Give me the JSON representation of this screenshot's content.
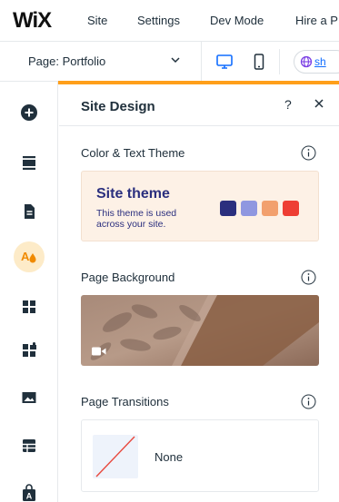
{
  "topbar": {
    "logo": "WiX",
    "menu": [
      "Site",
      "Settings",
      "Dev Mode",
      "Hire a P"
    ]
  },
  "pagebar": {
    "page_label": "Page: Portfolio",
    "site_button": "sh"
  },
  "sidebar": {
    "items": [
      {
        "icon": "add-icon"
      },
      {
        "icon": "sections-icon"
      },
      {
        "icon": "pages-icon"
      },
      {
        "icon": "site-design-icon",
        "active": true
      },
      {
        "icon": "apps-icon"
      },
      {
        "icon": "app-market-icon"
      },
      {
        "icon": "media-icon"
      },
      {
        "icon": "cms-icon"
      },
      {
        "icon": "business-tools-icon"
      }
    ]
  },
  "panel": {
    "title": "Site Design",
    "help": "?",
    "color_text": {
      "title": "Color & Text Theme",
      "theme_name": "Site theme",
      "theme_desc": "This theme is used across your site.",
      "swatches": [
        "#2b2f7e",
        "#8f97e0",
        "#f2a06e",
        "#ee3e34"
      ]
    },
    "background": {
      "title": "Page Background"
    },
    "transitions": {
      "title": "Page Transitions",
      "value": "None"
    }
  },
  "colors": {
    "accent": "#ff9f1a",
    "active_bg": "#fdebc8",
    "link": "#116dff"
  }
}
